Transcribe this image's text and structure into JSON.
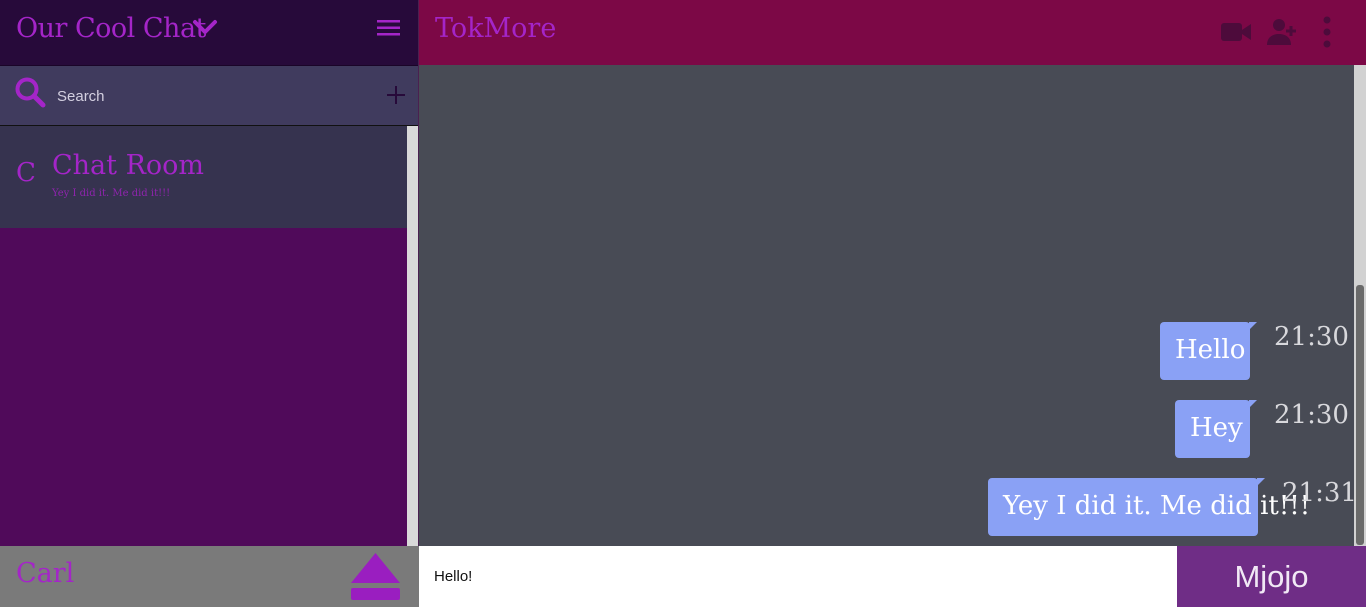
{
  "app": {
    "title": "Our Cool Chat",
    "accent_color": "#a425c8"
  },
  "search": {
    "placeholder": "Search",
    "value": ""
  },
  "chat_list": [
    {
      "avatar_letter": "C",
      "name": "Chat Room",
      "preview": "Yey I did it. Me did it!!!"
    }
  ],
  "user": {
    "name": "Carl"
  },
  "conversation": {
    "contact_name": "TokMore",
    "messages": [
      {
        "text": "Hello",
        "time": "21:30"
      },
      {
        "text": "Hey",
        "time": "21:30"
      },
      {
        "text": "Yey I did it. Me did it!!!",
        "time": "21:31"
      }
    ]
  },
  "composer": {
    "value": "Hello!",
    "send_label": "Mjojo"
  },
  "icons": {
    "title_toggle": "chevron-down-icon",
    "left_menu": "hamburger-menu-icon",
    "search": "search-icon",
    "add": "plus-icon",
    "logout": "eject-icon",
    "video": "video-camera-icon",
    "add_person": "add-person-icon",
    "more": "more-vertical-icon"
  }
}
